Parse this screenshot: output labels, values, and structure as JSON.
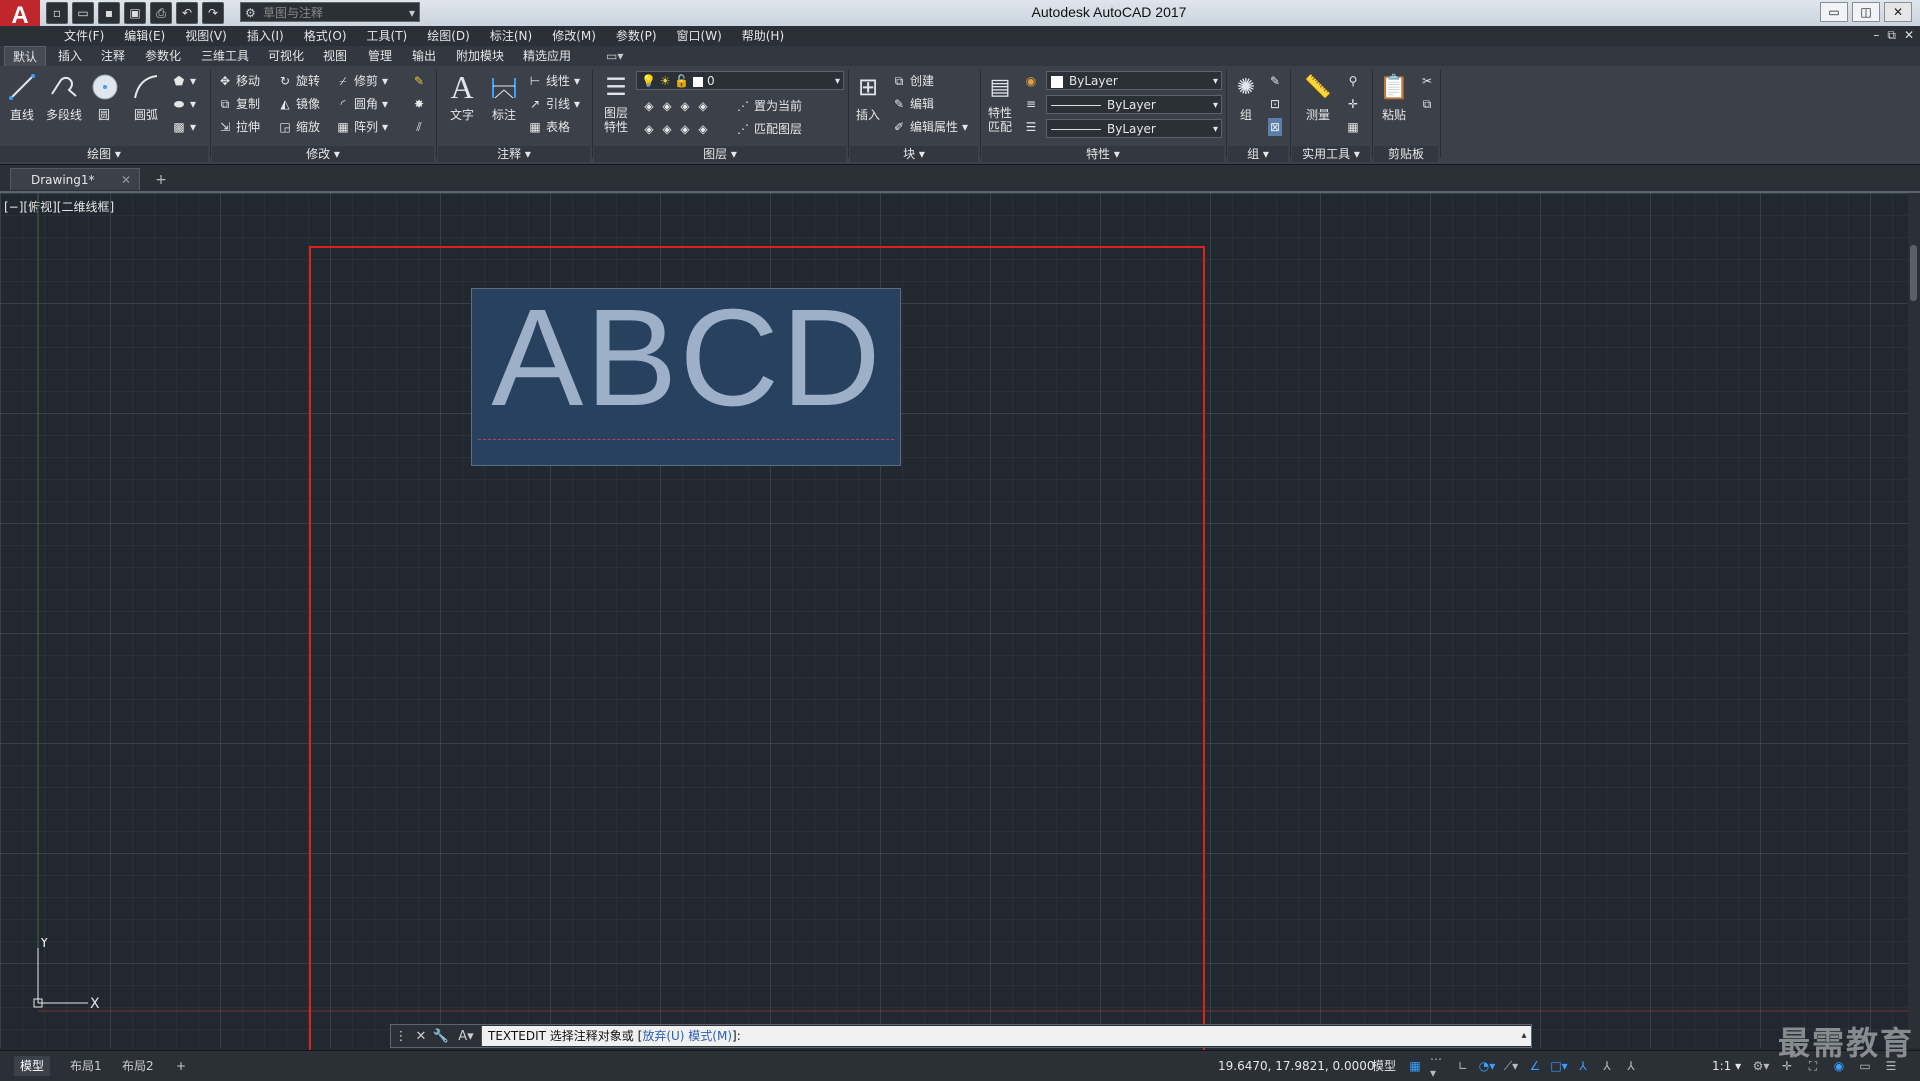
{
  "app": {
    "logo": "A",
    "title": "Autodesk AutoCAD 2017",
    "workspace": "草图与注释"
  },
  "quick_access": [
    "new-icon",
    "open-icon",
    "save-icon",
    "saveas-icon",
    "print-icon",
    "undo-icon",
    "redo-icon"
  ],
  "window_controls": {
    "minimize": "▭",
    "maximize": "◫",
    "close": "✕"
  },
  "menubar": [
    "文件(F)",
    "编辑(E)",
    "视图(V)",
    "插入(I)",
    "格式(O)",
    "工具(T)",
    "绘图(D)",
    "标注(N)",
    "修改(M)",
    "参数(P)",
    "窗口(W)",
    "帮助(H)"
  ],
  "doc_controls": {
    "minimize": "–",
    "restore": "⧉",
    "close": "✕"
  },
  "ribbon_tabs": [
    "默认",
    "插入",
    "注释",
    "参数化",
    "三维工具",
    "可视化",
    "视图",
    "管理",
    "输出",
    "附加模块",
    "精选应用"
  ],
  "ribbon": {
    "draw": {
      "title": "绘图",
      "line": "直线",
      "polyline": "多段线",
      "circle": "圆",
      "arc": "圆弧"
    },
    "modify": {
      "title": "修改",
      "move": "移动",
      "rotate": "旋转",
      "trim": "修剪",
      "copy": "复制",
      "mirror": "镜像",
      "fillet": "圆角",
      "stretch": "拉伸",
      "scale": "缩放",
      "array": "阵列"
    },
    "annotation": {
      "title": "注释",
      "text": "文字",
      "dimension": "标注",
      "linear": "线性",
      "leader": "引线",
      "table": "表格"
    },
    "layers": {
      "title": "图层",
      "layer_props": "图层\n特性",
      "current_layer": "0",
      "make_current": "置为当前",
      "match_layer": "匹配图层"
    },
    "block": {
      "title": "块",
      "insert": "插入",
      "create": "创建",
      "edit": "编辑",
      "edit_attr": "编辑属性"
    },
    "properties": {
      "title": "特性",
      "match": "特性\n匹配",
      "color": "ByLayer",
      "linetype": "ByLayer",
      "lineweight": "ByLayer"
    },
    "groups": {
      "title": "组",
      "group": "组"
    },
    "utilities": {
      "title": "实用工具",
      "measure": "测量"
    },
    "clipboard": {
      "title": "剪贴板",
      "paste": "粘贴"
    }
  },
  "file_tab": {
    "name": "Drawing1*"
  },
  "viewport": {
    "label": "[−][俯视][二维线框]"
  },
  "drawing": {
    "mtext": "ABCD",
    "ucs_x": "X",
    "ucs_y": "Y"
  },
  "command_line": {
    "command": "TEXTEDIT",
    "prompt": "选择注释对象或",
    "open_bracket": "[",
    "opt1": "放弃(U)",
    "opt2": "模式(M)",
    "close_bracket": "]:"
  },
  "status": {
    "layouts": [
      "模型",
      "布局1",
      "布局2"
    ],
    "coords": "19.6470, 17.9821, 0.0000",
    "mode": "模型",
    "scale": "1:1"
  },
  "watermark": "最需教育"
}
